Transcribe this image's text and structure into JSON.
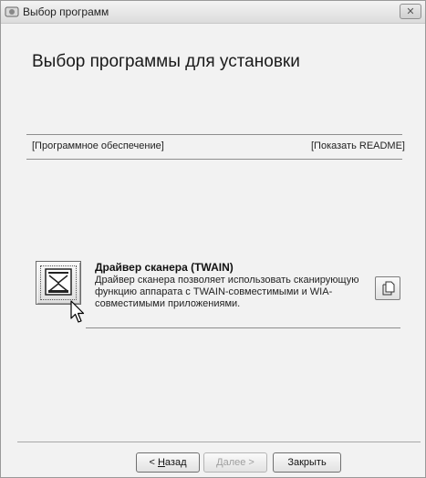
{
  "window": {
    "title": "Выбор программ",
    "close_label": "✕"
  },
  "page": {
    "heading": "Выбор программы для установки"
  },
  "links": {
    "software": "[Программное обеспечение]",
    "show_readme": "[Показать README]"
  },
  "program": {
    "title": "Драйвер сканера (TWAIN)",
    "description": "Драйвер сканера позволяет использовать сканирующую функцию аппарата с TWAIN-совместимыми и WIA-совместимыми приложениями.",
    "icon": "scanner-icon",
    "readme_icon": "document-icon"
  },
  "buttons": {
    "back_accel": "Н",
    "back_rest": "азад",
    "back_prefix": "< ",
    "next_accel": "Д",
    "next_rest": "алее",
    "next_suffix": " >",
    "close": "Закрыть"
  }
}
